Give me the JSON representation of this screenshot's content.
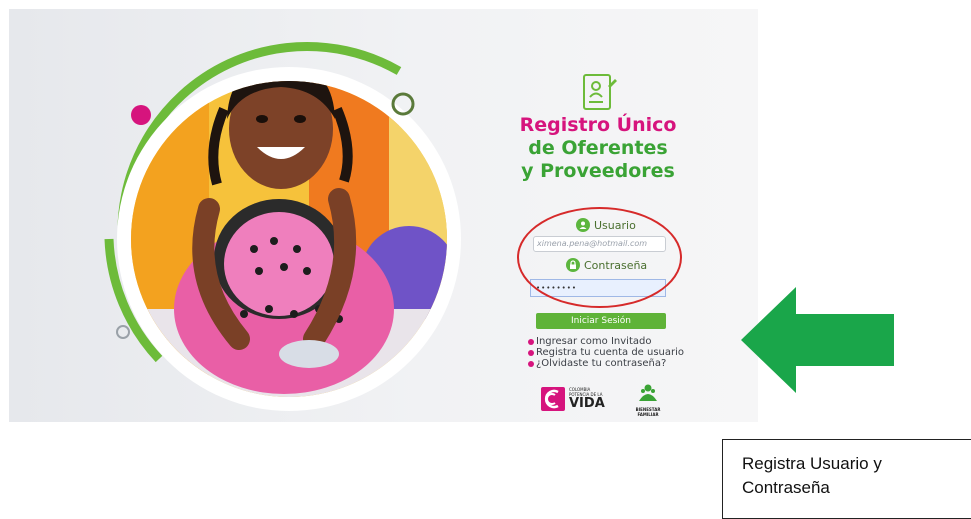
{
  "brand": {
    "title_line1": "Registro Único",
    "title_line2": "de Oferentes",
    "title_line3": "y Proveedores"
  },
  "login": {
    "user_label": "Usuario",
    "user_value": "ximena.pena@hotmail.com",
    "password_label": "Contraseña",
    "password_value": "••••••••",
    "submit_label": "Iniciar Sesión"
  },
  "links": {
    "guest": "Ingresar como Invitado",
    "register": "Registra tu cuenta de usuario",
    "forgot": "¿Olvidaste tu contraseña?"
  },
  "logos": {
    "colombia_line1": "COLOMBIA",
    "colombia_line2": "POTENCIA DE LA",
    "colombia_line3": "VIDA",
    "bienestar_line1": "BIENESTAR",
    "bienestar_line2": "FAMILIAR"
  },
  "annotation": {
    "callout_text": "Registra Usuario y Contraseña",
    "arrow_color": "#1aa64a",
    "ellipse_color": "#d62a2a"
  },
  "colors": {
    "brand_magenta": "#d6147d",
    "brand_green": "#3aa335",
    "button_green": "#5fb338"
  }
}
